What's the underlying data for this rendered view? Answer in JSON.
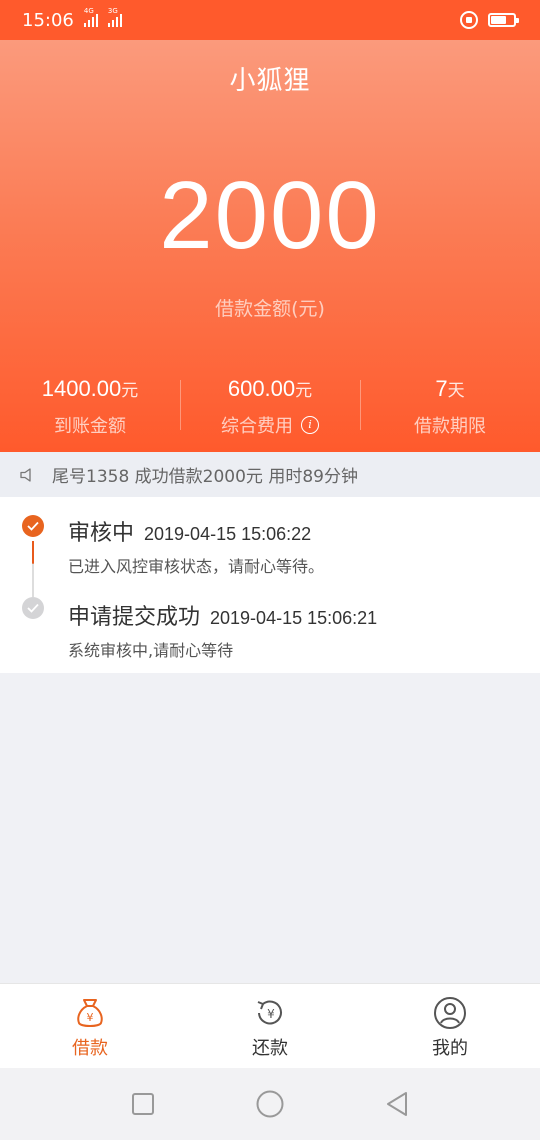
{
  "status_bar": {
    "time": "15:06",
    "sig1_tag": "4G",
    "sig2_tag": "3G",
    "battery_level": 0.7
  },
  "hero": {
    "title": "小狐狸",
    "amount": "2000",
    "amount_label": "借款金额(元)"
  },
  "stats": [
    {
      "value": "1400.00",
      "unit": "元",
      "label": "到账金额"
    },
    {
      "value": "600.00",
      "unit": "元",
      "label": "综合费用"
    },
    {
      "value": "7",
      "unit": "天",
      "label": "借款期限"
    }
  ],
  "notice": {
    "text": "尾号1358 成功借款2000元 用时89分钟"
  },
  "timeline": [
    {
      "title": "审核中",
      "time": "2019-04-15 15:06:22",
      "desc": "已进入风控审核状态，请耐心等待。",
      "state": "active"
    },
    {
      "title": "申请提交成功",
      "time": "2019-04-15 15:06:21",
      "desc": "系统审核中,请耐心等待",
      "state": "done"
    }
  ],
  "tabs": [
    {
      "label": "借款",
      "icon": "money-bag-icon",
      "active": true
    },
    {
      "label": "还款",
      "icon": "repay-icon",
      "active": false
    },
    {
      "label": "我的",
      "icon": "user-icon",
      "active": false
    }
  ],
  "colors": {
    "accent": "#e8641f",
    "header_top": "#fb9a7c",
    "header_bottom": "#ff5a2c"
  }
}
